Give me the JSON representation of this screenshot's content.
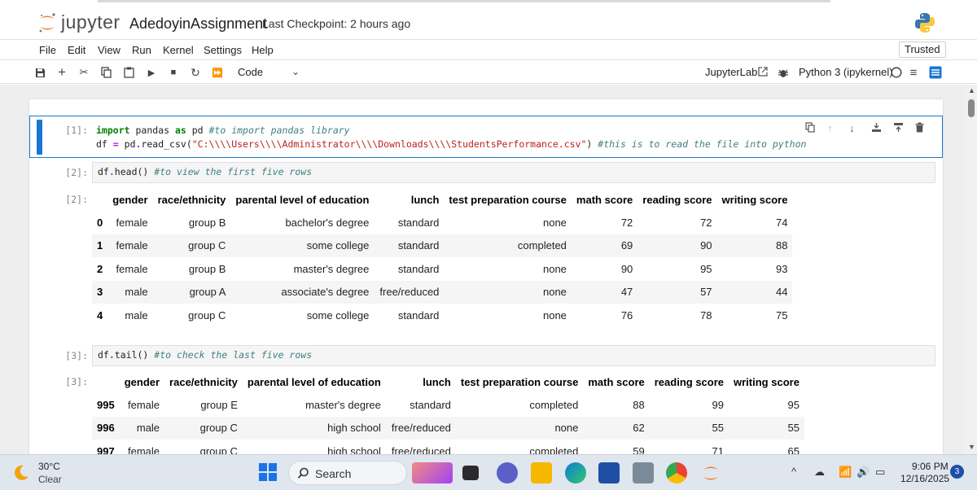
{
  "header": {
    "brand": "jupyter",
    "notebook_name": "AdedoyinAssignment",
    "checkpoint": "Last Checkpoint: 2 hours ago"
  },
  "menu": {
    "items": [
      "File",
      "Edit",
      "View",
      "Run",
      "Kernel",
      "Settings",
      "Help"
    ],
    "trusted": "Trusted"
  },
  "toolbar": {
    "cell_type": "Code",
    "jupyterlab": "JupyterLab",
    "kernel": "Python 3 (ipykernel)"
  },
  "cells": [
    {
      "prompt": "[1]:",
      "lines": [
        "import pandas as pd #to import pandas library",
        "df = pd.read_csv(\"C:\\\\Users\\\\Administrator\\\\Downloads\\\\StudentsPerformance.csv\") #this is to read the file into python"
      ]
    },
    {
      "prompt": "[2]:",
      "lines": [
        "df.head() #to view the first five rows"
      ],
      "out_prompt": "[2]:"
    },
    {
      "prompt": "[3]:",
      "lines": [
        "df.tail() #to check the last five rows"
      ],
      "out_prompt": "[3]:"
    }
  ],
  "head_table": {
    "columns": [
      "gender",
      "race/ethnicity",
      "parental level of education",
      "lunch",
      "test preparation course",
      "math score",
      "reading score",
      "writing score"
    ],
    "rows": [
      {
        "index": "0",
        "values": [
          "female",
          "group B",
          "bachelor's degree",
          "standard",
          "none",
          "72",
          "72",
          "74"
        ]
      },
      {
        "index": "1",
        "values": [
          "female",
          "group C",
          "some college",
          "standard",
          "completed",
          "69",
          "90",
          "88"
        ]
      },
      {
        "index": "2",
        "values": [
          "female",
          "group B",
          "master's degree",
          "standard",
          "none",
          "90",
          "95",
          "93"
        ]
      },
      {
        "index": "3",
        "values": [
          "male",
          "group A",
          "associate's degree",
          "free/reduced",
          "none",
          "47",
          "57",
          "44"
        ]
      },
      {
        "index": "4",
        "values": [
          "male",
          "group C",
          "some college",
          "standard",
          "none",
          "76",
          "78",
          "75"
        ]
      }
    ]
  },
  "tail_table": {
    "columns": [
      "gender",
      "race/ethnicity",
      "parental level of education",
      "lunch",
      "test preparation course",
      "math score",
      "reading score",
      "writing score"
    ],
    "rows": [
      {
        "index": "995",
        "values": [
          "female",
          "group E",
          "master's degree",
          "standard",
          "completed",
          "88",
          "99",
          "95"
        ]
      },
      {
        "index": "996",
        "values": [
          "male",
          "group C",
          "high school",
          "free/reduced",
          "none",
          "62",
          "55",
          "55"
        ]
      },
      {
        "index": "997",
        "values": [
          "female",
          "group C",
          "high school",
          "free/reduced",
          "completed",
          "59",
          "71",
          "65"
        ]
      }
    ]
  },
  "taskbar": {
    "temperature": "30°C",
    "condition": "Clear",
    "search_label": "Search",
    "time": "9:06 PM",
    "date": "12/16/2025",
    "notification_count": "3"
  },
  "colors": {
    "accent": "#1976d2",
    "keyword": "#008000",
    "comment": "#408080",
    "string": "#ba2121",
    "jupyter_orange": "#f37726"
  }
}
